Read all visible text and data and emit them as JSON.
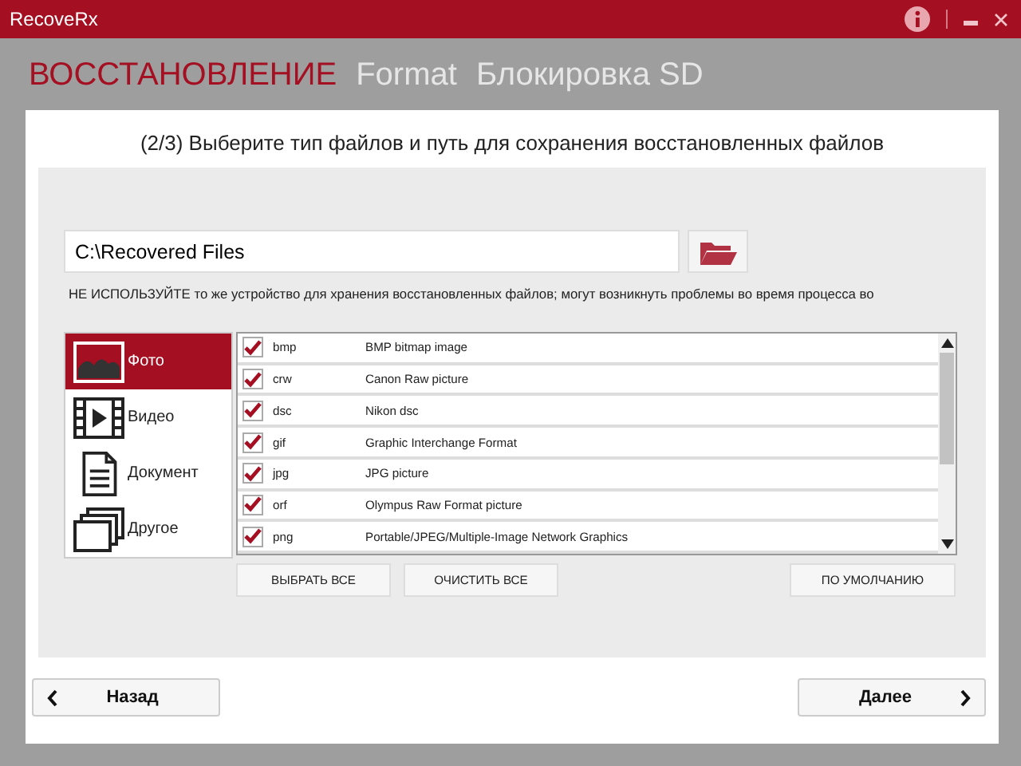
{
  "window": {
    "title": "RecoveRx"
  },
  "tabs": [
    {
      "label": "ВОССТАНОВЛЕНИЕ",
      "selected": true
    },
    {
      "label": "Format",
      "selected": false
    },
    {
      "label": "Блокировка SD",
      "selected": false
    }
  ],
  "heading": "(2/3) Выберите тип файлов и путь для сохранения восстановленных файлов",
  "path_field": {
    "value": "C:\\Recovered Files"
  },
  "warning": "НЕ ИСПОЛЬЗУЙТЕ то же устройство для хранения восстановленных файлов; могут возникнуть проблемы во время процесса во",
  "categories": [
    {
      "kind": "photo",
      "label": "Фото",
      "selected": true
    },
    {
      "kind": "video",
      "label": "Видео",
      "selected": false
    },
    {
      "kind": "document",
      "label": "Документ",
      "selected": false
    },
    {
      "kind": "other",
      "label": "Другое",
      "selected": false
    }
  ],
  "file_types": [
    {
      "ext": "bmp",
      "description": "BMP bitmap image",
      "checked": true
    },
    {
      "ext": "crw",
      "description": "Canon Raw picture",
      "checked": true
    },
    {
      "ext": "dsc",
      "description": "Nikon dsc",
      "checked": true
    },
    {
      "ext": "gif",
      "description": "Graphic Interchange Format",
      "checked": true
    },
    {
      "ext": "jpg",
      "description": "JPG picture",
      "checked": true
    },
    {
      "ext": "orf",
      "description": "Olympus Raw Format picture",
      "checked": true
    },
    {
      "ext": "png",
      "description": "Portable/JPEG/Multiple-Image Network Graphics",
      "checked": true
    }
  ],
  "list_buttons": [
    "ВЫБРАТЬ ВСЕ",
    "ОЧИСТИТЬ ВСЕ",
    "ПО УМОЛЧАНИЮ"
  ],
  "nav": {
    "back": "Назад",
    "next": "Далее"
  }
}
